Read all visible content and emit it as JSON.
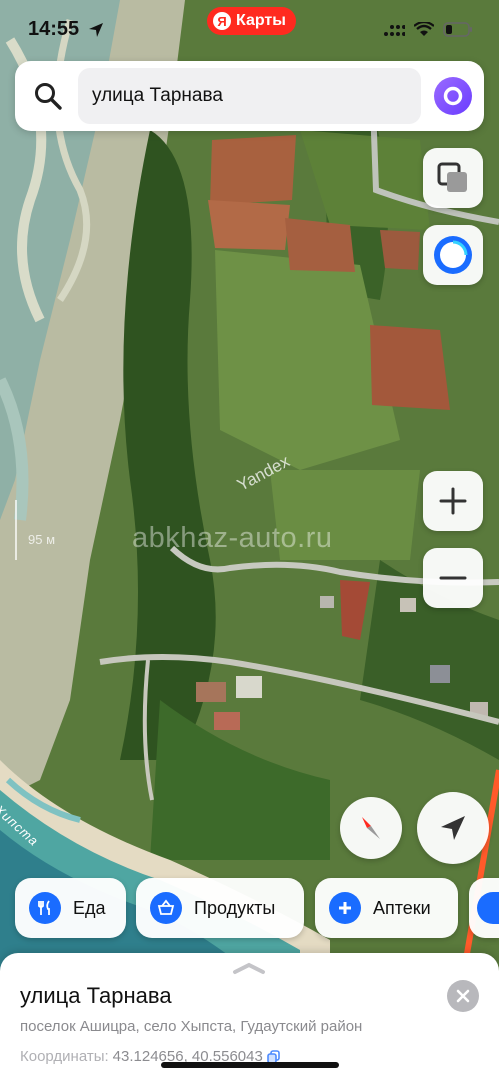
{
  "status_bar": {
    "time": "14:55",
    "brand_logo": "Я",
    "brand_name": "Карты"
  },
  "search": {
    "value": "улица Тарнава",
    "icons": {
      "search": "search-icon",
      "assistant": "alice-icon"
    }
  },
  "map": {
    "watermark_yandex": "Yandex",
    "watermark_site": "abkhaz-auto.ru",
    "scale_label": "95 м",
    "river_label": "Хипста",
    "colors": {
      "accent": "#1a6cff",
      "route": "#ff5a2a",
      "brand": "#ff2a1f",
      "assistant": "#7b4dff"
    }
  },
  "controls": {
    "layers": "layers-icon",
    "alice": "alice-icon",
    "zoom_in": "plus-icon",
    "zoom_out": "minus-icon",
    "compass": "compass-icon",
    "my_location": "navigation-arrow-icon"
  },
  "categories": [
    {
      "label": "Еда",
      "icon": "fork-knife-icon"
    },
    {
      "label": "Продукты",
      "icon": "basket-icon"
    },
    {
      "label": "Аптеки",
      "icon": "plus-cross-icon"
    }
  ],
  "place": {
    "title": "улица Тарнава",
    "subtitle": "поселок Ашицра, село Хыпста, Гудаутский район",
    "coords_label": "Координаты:",
    "coords_value": "43.124656, 40.556043"
  }
}
